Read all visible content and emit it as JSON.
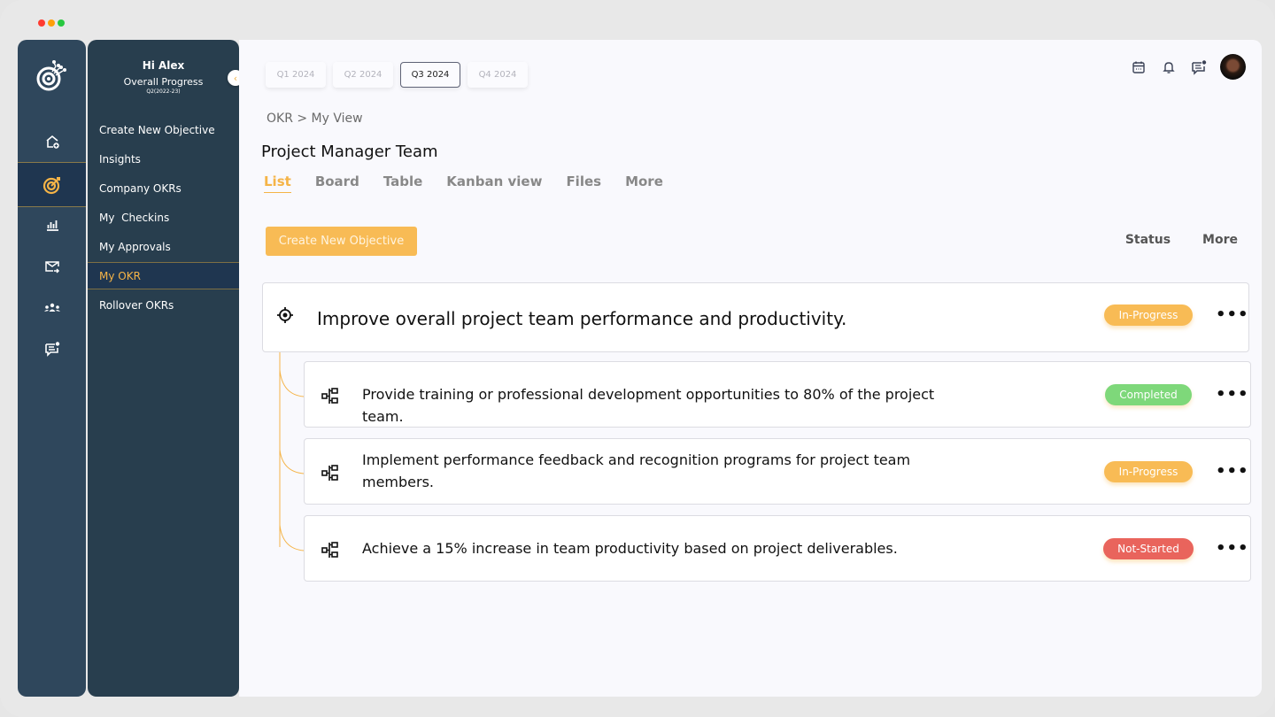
{
  "window": {
    "controls": {
      "close_color": "#ff3b30",
      "minimize_color": "#ff9f0a",
      "maximize_color": "#28c840"
    }
  },
  "rail": {
    "logo": "target-logo-icon",
    "items": [
      {
        "icon": "home-add-icon",
        "active": false
      },
      {
        "icon": "target-icon",
        "active": true
      },
      {
        "icon": "bar-chart-icon",
        "active": false
      },
      {
        "icon": "mail-forward-icon",
        "active": false
      },
      {
        "icon": "team-icon",
        "active": false
      },
      {
        "icon": "chat-notification-icon",
        "active": false
      }
    ]
  },
  "subnav": {
    "greeting": "Hi Alex",
    "progress_label": "Overall Progress",
    "period": "Q2(2022-23)",
    "items": [
      {
        "label": "Create New Objective",
        "active": false
      },
      {
        "label": "Insights",
        "active": false
      },
      {
        "label": "Company OKRs",
        "active": false
      },
      {
        "label": "My  Checkins",
        "active": false
      },
      {
        "label": "My Approvals",
        "active": false
      },
      {
        "label": "My OKR",
        "active": true
      },
      {
        "label": "Rollover OKRs",
        "active": false
      }
    ]
  },
  "quarters": [
    {
      "label": "Q1 2024",
      "active": false
    },
    {
      "label": "Q2 2024",
      "active": false
    },
    {
      "label": "Q3 2024",
      "active": true
    },
    {
      "label": "Q4 2024",
      "active": false
    }
  ],
  "header_icons": [
    "calendar-icon",
    "bell-icon",
    "chat-icon",
    "avatar"
  ],
  "breadcrumb": "OKR > My View",
  "page_title": "Project Manager Team",
  "view_tabs": [
    {
      "label": "List",
      "active": true
    },
    {
      "label": "Board",
      "active": false
    },
    {
      "label": "Table",
      "active": false
    },
    {
      "label": "Kanban view",
      "active": false
    },
    {
      "label": "Files",
      "active": false
    },
    {
      "label": "More",
      "active": false
    }
  ],
  "create_button": "Create New Objective",
  "actions": {
    "status": "Status",
    "more": "More"
  },
  "objective": {
    "title": "Improve overall project team performance and productivity.",
    "status": "In-Progress",
    "menu": "•••"
  },
  "key_results": [
    {
      "text": "Provide training or professional development opportunities to 80% of the project team.",
      "status": "Completed",
      "menu": "•••"
    },
    {
      "text": "Implement performance feedback and recognition programs for project team members.",
      "status": "In-Progress",
      "menu": "•••"
    },
    {
      "text": "Achieve a 15% increase in team productivity based on project deliverables.",
      "status": "Not-Started",
      "menu": "•••"
    }
  ],
  "colors": {
    "accent": "#f5b447",
    "in_progress": "#f8bb55",
    "completed": "#7ed87a",
    "not_started": "#e9645c",
    "rail_bg": "#2f475c",
    "subnav_bg": "#283e4e"
  }
}
